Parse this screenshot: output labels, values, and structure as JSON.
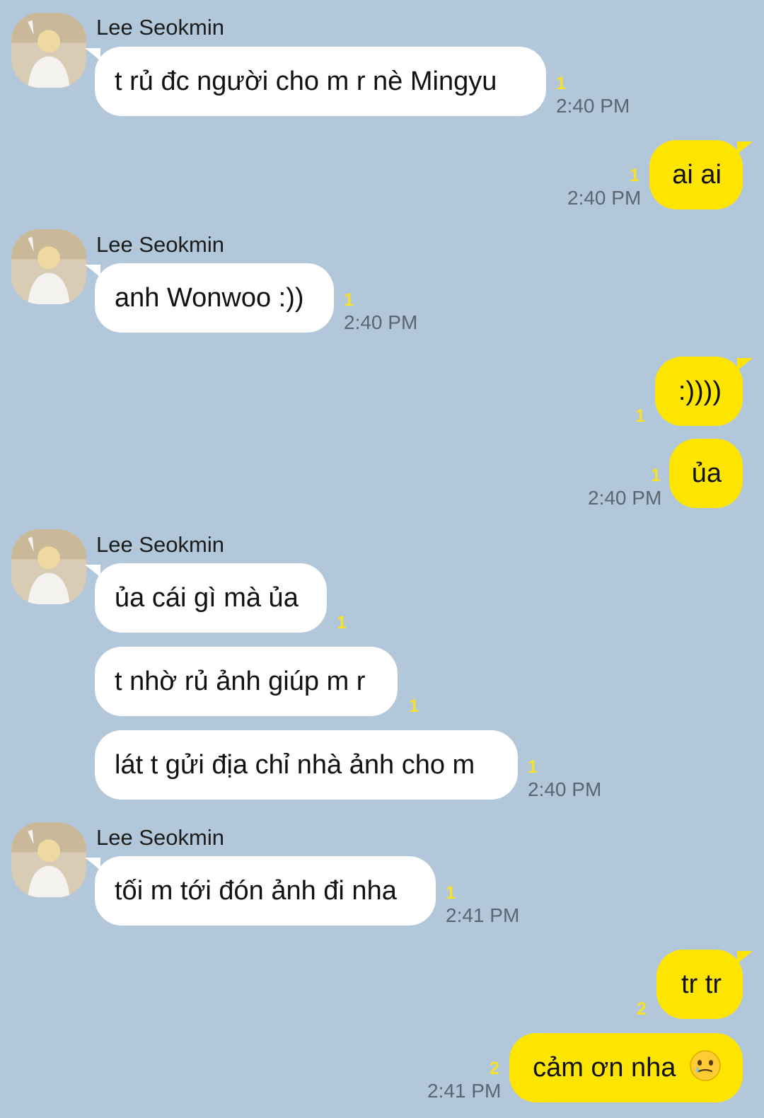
{
  "colors": {
    "background": "#b2c7da",
    "incoming_bubble": "#ffffff",
    "outgoing_bubble": "#fee500",
    "unread_count": "#f5e12a",
    "timestamp": "#5b6670"
  },
  "messages": [
    {
      "sender": "Lee Seokmin",
      "direction": "in",
      "text": "t rủ đc người cho m r nè Mingyu",
      "unread": "1",
      "time": "2:40 PM"
    },
    {
      "direction": "out",
      "text": "ai ai",
      "unread": "1",
      "time": "2:40 PM"
    },
    {
      "sender": "Lee Seokmin",
      "direction": "in",
      "text": "anh Wonwoo :))",
      "unread": "1",
      "time": "2:40 PM"
    },
    {
      "direction": "out",
      "text": ":))))",
      "unread": "1"
    },
    {
      "direction": "out",
      "text": "ủa",
      "unread": "1",
      "time": "2:40 PM"
    },
    {
      "sender": "Lee Seokmin",
      "direction": "in",
      "text": "ủa cái gì mà ủa",
      "unread": "1"
    },
    {
      "direction": "in",
      "text": "t nhờ rủ ảnh giúp m r",
      "unread": "1"
    },
    {
      "direction": "in",
      "text": "lát t gửi địa chỉ nhà ảnh cho m",
      "unread": "1",
      "time": "2:40 PM"
    },
    {
      "sender": "Lee Seokmin",
      "direction": "in",
      "text": "tối m tới đón ảnh đi nha",
      "unread": "1",
      "time": "2:41 PM"
    },
    {
      "direction": "out",
      "text": "tr tr",
      "unread": "2"
    },
    {
      "direction": "out",
      "text": "cảm ơn nha",
      "emoji": "face-holding-back-tears-emoji",
      "unread": "2",
      "time": "2:41 PM"
    }
  ]
}
